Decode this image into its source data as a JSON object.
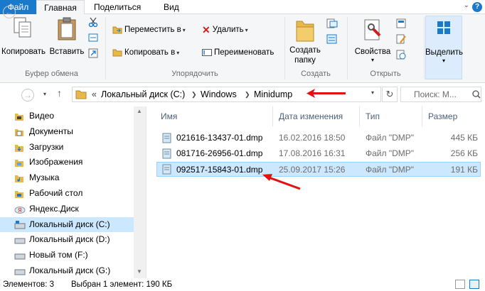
{
  "tabs": [
    "Файл",
    "Главная",
    "Поделиться",
    "Вид"
  ],
  "ribbon": {
    "clipboard": {
      "copy": "Копировать",
      "paste": "Вставить",
      "label": "Буфер обмена"
    },
    "organize": {
      "move_to": "Переместить в",
      "copy_to": "Копировать в",
      "delete": "Удалить",
      "rename": "Переименовать",
      "label": "Упорядочить"
    },
    "create": {
      "new_folder_line1": "Создать",
      "new_folder_line2": "папку",
      "label": "Создать"
    },
    "open": {
      "properties": "Свойства",
      "label": "Открыть"
    },
    "select": {
      "select": "Выделить"
    }
  },
  "address": {
    "overflow": "«",
    "crumbs": [
      "Локальный диск (C:)",
      "Windows",
      "Minidump"
    ],
    "search_placeholder": "Поиск: М..."
  },
  "nav_items": [
    {
      "label": "Видео",
      "icon": "video-folder-icon"
    },
    {
      "label": "Документы",
      "icon": "documents-folder-icon"
    },
    {
      "label": "Загрузки",
      "icon": "downloads-folder-icon"
    },
    {
      "label": "Изображения",
      "icon": "pictures-folder-icon"
    },
    {
      "label": "Музыка",
      "icon": "music-folder-icon"
    },
    {
      "label": "Рабочий стол",
      "icon": "desktop-folder-icon"
    },
    {
      "label": "Яндекс.Диск",
      "icon": "yandex-disk-icon"
    },
    {
      "label": "Локальный диск (C:)",
      "icon": "system-drive-icon"
    },
    {
      "label": "Локальный диск (D:)",
      "icon": "drive-icon"
    },
    {
      "label": "Новый том (F:)",
      "icon": "drive-icon"
    },
    {
      "label": "Локальный диск (G:)",
      "icon": "drive-icon"
    }
  ],
  "columns": [
    "Имя",
    "Дата изменения",
    "Тип",
    "Размер"
  ],
  "files": [
    {
      "name": "021616-13437-01.dmp",
      "date": "16.02.2016 18:50",
      "type": "Файл \"DMP\"",
      "size": "445 КБ"
    },
    {
      "name": "081716-26956-01.dmp",
      "date": "17.08.2016 16:31",
      "type": "Файл \"DMP\"",
      "size": "256 КБ"
    },
    {
      "name": "092517-15843-01.dmp",
      "date": "25.09.2017 15:26",
      "type": "Файл \"DMP\"",
      "size": "191 КБ"
    }
  ],
  "status": {
    "items": "Элементов: 3",
    "selected": "Выбран 1 элемент: 190 КБ"
  },
  "colors": {
    "accent": "#1979ca",
    "selection": "#cce8ff",
    "arrow": "#e4100f",
    "folder": "#e8b84a"
  }
}
